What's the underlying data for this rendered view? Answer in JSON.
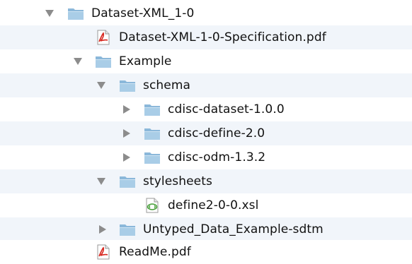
{
  "finder_tree": {
    "rows": [
      {
        "label": "Dataset-XML_1-0",
        "type": "folder",
        "expanded": true
      },
      {
        "label": "Dataset-XML-1-0-Specification.pdf",
        "type": "pdf"
      },
      {
        "label": "Example",
        "type": "folder",
        "expanded": true
      },
      {
        "label": "schema",
        "type": "folder",
        "expanded": true
      },
      {
        "label": "cdisc-dataset-1.0.0",
        "type": "folder",
        "expanded": false
      },
      {
        "label": "cdisc-define-2.0",
        "type": "folder",
        "expanded": false
      },
      {
        "label": "cdisc-odm-1.3.2",
        "type": "folder",
        "expanded": false
      },
      {
        "label": "stylesheets",
        "type": "folder",
        "expanded": true
      },
      {
        "label": "define2-0-0.xsl",
        "type": "xsl"
      },
      {
        "label": "Untyped_Data_Example-sdtm",
        "type": "folder",
        "expanded": false
      },
      {
        "label": "ReadMe.pdf",
        "type": "pdf"
      }
    ]
  },
  "colors": {
    "stripe": "#f1f5fa",
    "folder_body": "#a9cde7",
    "folder_tab": "#8bb8da",
    "disclosure": "#8c8c8c",
    "pdf_red": "#d7261e",
    "xsl_green": "#3d9a2e"
  }
}
